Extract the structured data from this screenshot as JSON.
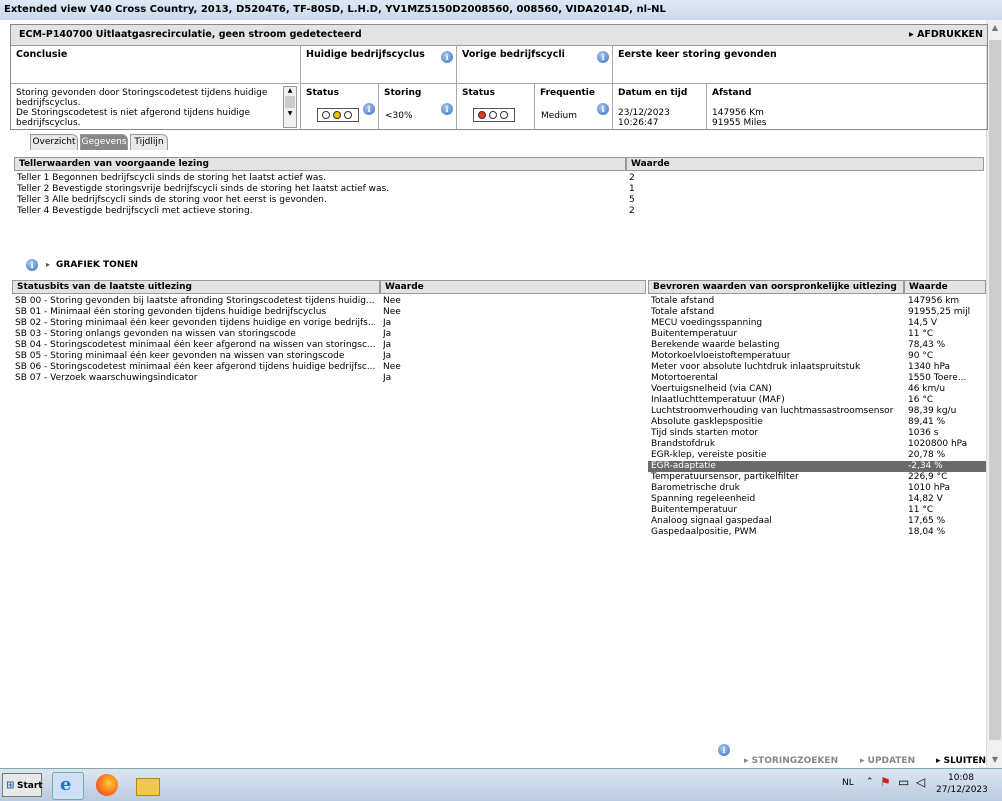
{
  "window": {
    "title": "Extended view  V40 Cross Country, 2013, D5204T6, TF-80SD, L.H.D, YV1MZ5150D2008560, 008560, VIDA2014D, nl-NL"
  },
  "header": {
    "title": "ECM-P140700 Uitlaatgasrecirculatie, geen stroom gedetecteerd",
    "print_label": "AFDRUKKEN",
    "conclusion_heading": "Conclusie",
    "conclusion_text": [
      "Storing gevonden door Storingscodetest tijdens huidige",
      "bedrijfscyclus.",
      "De Storingscodetest is niet afgerond tijdens huidige",
      "bedrijfscyclus."
    ],
    "current_cycle": {
      "heading": "Huidige bedrijfscyclus",
      "status_label": "Status",
      "fault_label": "Storing",
      "fault_value": "<30%",
      "lamp": "yellow"
    },
    "previous_cycle": {
      "heading": "Vorige bedrijfscycli",
      "status_label": "Status",
      "freq_label": "Frequentie",
      "freq_value": "Medium",
      "lamp": "red"
    },
    "first_found": {
      "heading": "Eerste keer storing gevonden",
      "date_label": "Datum en tijd",
      "date_value": "23/12/2023",
      "time_value": "10:26:47",
      "distance_label": "Afstand",
      "distance_km": "147956 Km",
      "distance_miles": "91955 Miles"
    }
  },
  "tabs": [
    {
      "label": "Overzicht",
      "active": false
    },
    {
      "label": "Gegevens",
      "active": true
    },
    {
      "label": "Tijdlijn",
      "active": false
    }
  ],
  "counters": {
    "heading": "Tellerwaarden van voorgaande lezing",
    "value_heading": "Waarde",
    "rows": [
      {
        "label": "Teller 1 Begonnen bedrijfscycli sinds de storing het laatst actief was.",
        "value": "2"
      },
      {
        "label": "Teller 2 Bevestigde storingsvrije bedrijfscycli sinds de storing het laatst actief was.",
        "value": "1"
      },
      {
        "label": "Teller 3 Alle bedrijfscycli sinds de storing voor het eerst is gevonden.",
        "value": "5"
      },
      {
        "label": "Teller 4 Bevestigde bedrijfscycli met actieve storing.",
        "value": "2"
      }
    ]
  },
  "graph_label": "GRAFIEK TONEN",
  "statusbits": {
    "heading": "Statusbits van de laatste uitlezing",
    "value_heading": "Waarde",
    "rows": [
      {
        "label": "SB 00 - Storing gevonden bij laatste afronding Storingscodetest tijdens huidig...",
        "value": "Nee"
      },
      {
        "label": "SB 01 - Minimaal één storing gevonden tijdens huidige bedrijfscyclus",
        "value": "Nee"
      },
      {
        "label": "SB 02 - Storing minimaal één keer gevonden tijdens huidige en vorige bedrijfs...",
        "value": "Ja"
      },
      {
        "label": "SB 03 - Storing onlangs gevonden na wissen van storingscode",
        "value": "Ja"
      },
      {
        "label": "SB 04 - Storingscodetest minimaal één keer afgerond na wissen van storingsc...",
        "value": "Ja"
      },
      {
        "label": "SB 05 - Storing minimaal één keer gevonden na wissen van storingscode",
        "value": "Ja"
      },
      {
        "label": "SB 06 - Storingscodetest minimaal één keer afgerond tijdens huidige bedrijfsc...",
        "value": "Nee"
      },
      {
        "label": "SB 07 - Verzoek waarschuwingsindicator",
        "value": "Ja"
      }
    ]
  },
  "frozen": {
    "heading": "Bevroren waarden van oorspronkelijke uitlezing",
    "value_heading": "Waarde",
    "selected_index": 15,
    "rows": [
      {
        "label": "Totale afstand",
        "value": "147956 km"
      },
      {
        "label": "Totale afstand",
        "value": "91955,25 mijl"
      },
      {
        "label": "MECU voedingsspanning",
        "value": "14,5 V"
      },
      {
        "label": "Buitentemperatuur",
        "value": "11 °C"
      },
      {
        "label": "Berekende waarde belasting",
        "value": "78,43 %"
      },
      {
        "label": "Motorkoelvloeistoftemperatuur",
        "value": "90 °C"
      },
      {
        "label": "Meter voor absolute luchtdruk inlaatspruitstuk",
        "value": "1340 hPa"
      },
      {
        "label": "Motortoerental",
        "value": "1550 Toere..."
      },
      {
        "label": "Voertuigsnelheid (via CAN)",
        "value": "46 km/u"
      },
      {
        "label": "Inlaatluchttemperatuur (MAF)",
        "value": "16 °C"
      },
      {
        "label": "Luchtstroomverhouding van luchtmassastroomsensor",
        "value": "98,39 kg/u"
      },
      {
        "label": "Absolute gasklepspositie",
        "value": "89,41 %"
      },
      {
        "label": "Tijd sinds starten motor",
        "value": "1036 s"
      },
      {
        "label": "Brandstofdruk",
        "value": "1020800 hPa"
      },
      {
        "label": "EGR-klep, vereiste positie",
        "value": "20,78 %"
      },
      {
        "label": "EGR-adaptatie",
        "value": "-2,34 %"
      },
      {
        "label": "Temperatuursensor, partikelfilter",
        "value": "226,9 °C"
      },
      {
        "label": "Barometrische druk",
        "value": "1010 hPa"
      },
      {
        "label": "Spanning regeleenheid",
        "value": "14,82 V"
      },
      {
        "label": "Buitentemperatuur",
        "value": "11 °C"
      },
      {
        "label": "Analoog signaal gaspedaal",
        "value": "17,65 %"
      },
      {
        "label": "Gaspedaalpositie, PWM",
        "value": "18,04 %"
      }
    ]
  },
  "footer": {
    "search": "STORINGZOEKEN",
    "update": "UPDATEN",
    "close": "SLUITEN"
  },
  "taskbar": {
    "start": "Start",
    "lang": "NL",
    "time": "10:08",
    "date": "27/12/2023"
  }
}
